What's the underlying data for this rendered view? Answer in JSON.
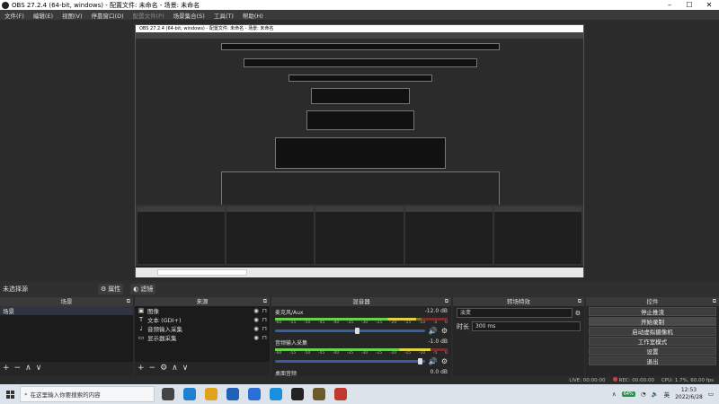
{
  "window": {
    "title": "OBS 27.2.4 (64-bit, windows) - 配置文件: 未命名 - 场景: 未命名"
  },
  "menu": [
    "文件(F)",
    "编辑(E)",
    "视图(V)",
    "停靠窗口(D)",
    "配置文件(P)",
    "场景集合(S)",
    "工具(T)",
    "帮助(H)"
  ],
  "menu_dim_index": 4,
  "status": {
    "no_source": "未选择源",
    "properties": "属性",
    "filters": "滤镜"
  },
  "scenes": {
    "header": "场景",
    "items": [
      "场景"
    ]
  },
  "sources": {
    "header": "来源",
    "items": [
      {
        "label": "图像",
        "icon": "image-icon"
      },
      {
        "label": "文本 (GDI+)",
        "icon": "text-icon"
      },
      {
        "label": "音频输入采集",
        "icon": "microphone-icon"
      },
      {
        "label": "显示器采集",
        "icon": "monitor-icon"
      }
    ]
  },
  "mixer": {
    "header": "混音器",
    "channels": [
      {
        "name": "麦克风/Aux",
        "db": "-12.0 dB",
        "level": 0.82,
        "volume": 0.55
      },
      {
        "name": "音频输入采集",
        "db": "-1.0 dB",
        "level": 0.9,
        "volume": 0.97
      },
      {
        "name": "桌面音频",
        "db": "0.0 dB"
      }
    ],
    "ticks": [
      "-60",
      "-55",
      "-50",
      "-45",
      "-40",
      "-35",
      "-30",
      "-25",
      "-20",
      "-15",
      "-10",
      "-5",
      "0"
    ]
  },
  "transitions": {
    "header": "转场特效",
    "type": "淡变",
    "duration_label": "时长",
    "duration_value": "300 ms"
  },
  "controls": {
    "header": "控件",
    "buttons": [
      "停止推流",
      "开始录制",
      "启动虚拟摄像机",
      "工作室模式",
      "设置",
      "退出"
    ]
  },
  "stats": {
    "live": "LIVE: 00:00:00",
    "rec": "REC: 00:00:00",
    "cpu": "CPU: 1.7%, 60.00 fps"
  },
  "taskbar": {
    "search_placeholder": "在这里输入你要搜索的内容",
    "time": "12:53",
    "date": "2022/6/28",
    "ime": "英",
    "battery": "64%",
    "apps": [
      {
        "icon": "task-view-icon",
        "color": "#444444"
      },
      {
        "icon": "edge-icon",
        "color": "#1f7fd0"
      },
      {
        "icon": "folder-icon",
        "color": "#e0a21b"
      },
      {
        "icon": "mail-icon",
        "color": "#1e63b5"
      },
      {
        "icon": "lenovo-icon",
        "color": "#2a6fd6"
      },
      {
        "icon": "app-icon",
        "color": "#1a8fe0"
      },
      {
        "icon": "obs-icon",
        "color": "#222222"
      },
      {
        "icon": "game-icon",
        "color": "#6b5b2a"
      },
      {
        "icon": "recorder-icon",
        "color": "#c0392b"
      }
    ]
  },
  "colors": {
    "bg": "#2b2b2b",
    "dock": "#262626",
    "accent": "#3a5fa0"
  }
}
